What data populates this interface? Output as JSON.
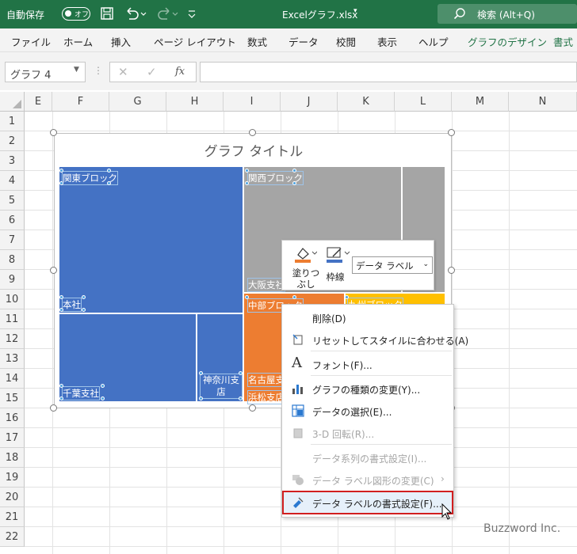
{
  "titlebar": {
    "autosave_label": "自動保存",
    "autosave_state": "オフ",
    "filename": "Excelグラフ.xlsx",
    "search_placeholder": "検索 (Alt+Q)"
  },
  "tabs": [
    "ファイル",
    "ホーム",
    "挿入",
    "ページ レイアウト",
    "数式",
    "データ",
    "校閲",
    "表示",
    "ヘルプ",
    "グラフのデザイン",
    "書式"
  ],
  "formula": {
    "namebox": "グラフ 4",
    "fx": "fx"
  },
  "columns": [
    "E",
    "F",
    "G",
    "H",
    "I",
    "J",
    "K",
    "L",
    "M",
    "N"
  ],
  "rows": [
    "1",
    "2",
    "3",
    "4",
    "5",
    "6",
    "7",
    "8",
    "9",
    "10",
    "11",
    "12",
    "13",
    "14",
    "15",
    "16",
    "17",
    "18",
    "19",
    "20",
    "21",
    "22"
  ],
  "chart": {
    "title": "グラフ タイトル",
    "labels": {
      "kanto": "関東ブロック",
      "kansai": "関西ブロック",
      "honsha": "本社",
      "osaka": "大阪支社",
      "chubu": "中部ブロック",
      "kyushu": "九州ブロック",
      "chiba": "千葉支社",
      "kanagawa": "神奈川支店",
      "nagoya": "名古屋支",
      "hamamatsu": "浜松支店"
    },
    "colors": {
      "kanto": "#4472c4",
      "kansai": "#a5a5a5",
      "chubu": "#ed7d31",
      "kyushu": "#ffc000"
    }
  },
  "mini_toolbar": {
    "fill_label": "塗りつぶし",
    "outline_label": "枠線",
    "select_value": "データ ラベル"
  },
  "context_menu": [
    {
      "label": "削除(D)",
      "icon": "delete-icon",
      "enabled": true
    },
    {
      "label": "リセットしてスタイルに合わせる(A)",
      "icon": "reset-style-icon",
      "enabled": true
    },
    {
      "label": "フォント(F)...",
      "icon": "font-icon",
      "enabled": true
    },
    {
      "label": "グラフの種類の変更(Y)...",
      "icon": "chart-type-icon",
      "enabled": true
    },
    {
      "label": "データの選択(E)...",
      "icon": "select-data-icon",
      "enabled": true
    },
    {
      "label": "3-D 回転(R)...",
      "icon": "rotate-3d-icon",
      "enabled": false
    },
    {
      "label": "データ系列の書式設定(I)...",
      "icon": "",
      "enabled": false
    },
    {
      "label": "データ ラベル図形の変更(C)",
      "icon": "label-shape-icon",
      "enabled": false
    },
    {
      "label": "データ ラベルの書式設定(F)...",
      "icon": "format-label-icon",
      "enabled": true
    }
  ],
  "watermark": "Buzzword Inc."
}
